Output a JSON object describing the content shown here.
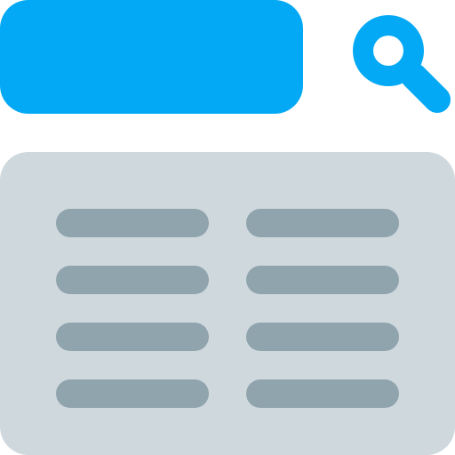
{
  "colors": {
    "accent": "#03A9F4",
    "panel": "#CFD8DC",
    "line": "#90A4AE",
    "icon_hole": "#FFFFFF"
  },
  "search": {
    "value": "",
    "placeholder": ""
  },
  "icons": {
    "search": "search-icon"
  },
  "results": {
    "columns": 2,
    "rows": 4,
    "items": [
      "",
      "",
      "",
      "",
      "",
      "",
      "",
      ""
    ]
  }
}
